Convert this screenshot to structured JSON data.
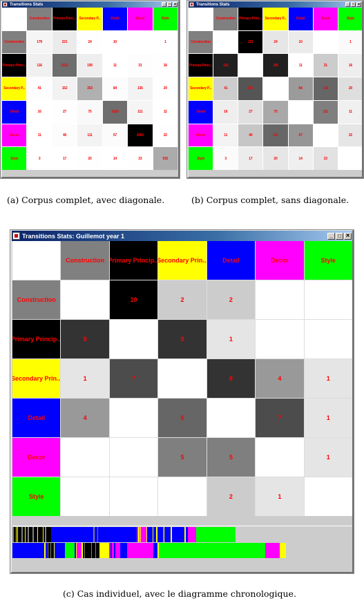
{
  "categories": [
    "Construction",
    "Primary Principle",
    "Secondary Principle",
    "Detail",
    "Decor",
    "Style"
  ],
  "category_colors": {
    "Construction": "#808080",
    "Primary Principle": "#000000",
    "Secondary Principle": "#ffff00",
    "Detail": "#0000ff",
    "Decor": "#ff00ff",
    "Style": "#00ff00"
  },
  "label_color": "#ff0000",
  "windows": {
    "a": {
      "title": "Transitions Stats",
      "header_labels": [
        "Construction",
        "Primary Princ...",
        "Secondary P...",
        "Detail",
        "Decor",
        "Style"
      ],
      "row_labels": [
        "Construction",
        "Primary Princ...",
        "Secondary P...",
        "Detail",
        "Decor",
        "Style"
      ],
      "values": [
        [
          "179",
          "221",
          "24",
          "10",
          "",
          "1"
        ],
        [
          "116",
          "1012",
          "195",
          "11",
          "31",
          "16"
        ],
        [
          "41",
          "152",
          "353",
          "84",
          "136",
          "20"
        ],
        [
          "16",
          "27",
          "75",
          "1620",
          "111",
          "11"
        ],
        [
          "11",
          "40",
          "111",
          "57",
          "2060",
          "22"
        ],
        [
          "3",
          "17",
          "20",
          "14",
          "23",
          "915"
        ]
      ],
      "shades": [
        [
          "#f5f5f5",
          "#ebebeb",
          "#fefefe",
          "#ffffff",
          "#ffffff",
          "#ffffff"
        ],
        [
          "#f0f0f0",
          "#6e6e6e",
          "#eeeeee",
          "#ffffff",
          "#fdfdfd",
          "#fefefe"
        ],
        [
          "#fdfdfd",
          "#f2f2f2",
          "#b0b0b0",
          "#fcfcfc",
          "#f3f3f3",
          "#fefefe"
        ],
        [
          "#ffffff",
          "#fefefe",
          "#f9f9f9",
          "#6e6e6e",
          "#f5f5f5",
          "#ffffff"
        ],
        [
          "#ffffff",
          "#fcfcfc",
          "#f3f3f3",
          "#fbfbfb",
          "#000000",
          "#fefefe"
        ],
        [
          "#ffffff",
          "#ffffff",
          "#fefefe",
          "#ffffff",
          "#fefefe",
          "#ababab"
        ]
      ]
    },
    "b": {
      "title": "Transitions Stats",
      "header_labels": [
        "Construction",
        "Primary Princ...",
        "Secondary P...",
        "Detail",
        "Decor",
        "Style"
      ],
      "row_labels": [
        "Construction",
        "Primary Princ...",
        "Secondary P...",
        "Detail",
        "Decor",
        "Style"
      ],
      "values": [
        [
          "",
          "221",
          "24",
          "10",
          "",
          "1"
        ],
        [
          "116",
          "",
          "195",
          "11",
          "31",
          "16"
        ],
        [
          "41",
          "152",
          "",
          "84",
          "136",
          "20"
        ],
        [
          "16",
          "27",
          "75",
          "",
          "111",
          "11"
        ],
        [
          "11",
          "40",
          "111",
          "57",
          "",
          "22"
        ],
        [
          "3",
          "17",
          "20",
          "14",
          "23",
          ""
        ]
      ],
      "shades": [
        [
          "#ffffff",
          "#000000",
          "#e6e6e6",
          "#ebebeb",
          "#ffffff",
          "#fafafa"
        ],
        [
          "#202020",
          "#ffffff",
          "#202020",
          "#ffffff",
          "#cccccc",
          "#eeeeee"
        ],
        [
          "#cdcdcd",
          "#555555",
          "#ffffff",
          "#9b9b9b",
          "#666666",
          "#dedede"
        ],
        [
          "#eeeeee",
          "#e0e0e0",
          "#a9a9a9",
          "#ffffff",
          "#7f7f7f",
          "#f0f0f0"
        ],
        [
          "#f3f3f3",
          "#c6c6c6",
          "#676767",
          "#969696",
          "#ffffff",
          "#e6e6e6"
        ],
        [
          "#fbfbfb",
          "#ececec",
          "#e6e6e6",
          "#efefef",
          "#e2e2e2",
          "#ffffff"
        ]
      ]
    },
    "c": {
      "title": "Transitions Stats: Guillemot year 1",
      "header_labels": [
        "Construction",
        "Primary Princip...",
        "Secondary Prin...",
        "Detail",
        "Decor",
        "Style"
      ],
      "row_labels": [
        "Construction",
        "Primary Princip...",
        "Secondary Prin...",
        "Detail",
        "Decor",
        "Style"
      ],
      "values": [
        [
          "",
          "10",
          "2",
          "2",
          "",
          ""
        ],
        [
          "8",
          "",
          "8",
          "1",
          "",
          ""
        ],
        [
          "1",
          "7",
          "",
          "8",
          "4",
          "1"
        ],
        [
          "4",
          "",
          "6",
          "",
          "7",
          "1"
        ],
        [
          "",
          "",
          "5",
          "5",
          "",
          "1"
        ],
        [
          "",
          "",
          "",
          "2",
          "1",
          ""
        ]
      ],
      "shades": [
        [
          "#ffffff",
          "#000000",
          "#cccccc",
          "#cccccc",
          "#ffffff",
          "#ffffff"
        ],
        [
          "#333333",
          "#ffffff",
          "#333333",
          "#e5e5e5",
          "#ffffff",
          "#ffffff"
        ],
        [
          "#e5e5e5",
          "#4c4c4c",
          "#ffffff",
          "#333333",
          "#999999",
          "#e5e5e5"
        ],
        [
          "#999999",
          "#ffffff",
          "#666666",
          "#ffffff",
          "#4c4c4c",
          "#e5e5e5"
        ],
        [
          "#ffffff",
          "#ffffff",
          "#7f7f7f",
          "#7f7f7f",
          "#ffffff",
          "#e5e5e5"
        ],
        [
          "#ffffff",
          "#ffffff",
          "#ffffff",
          "#cccccc",
          "#e5e5e5",
          "#ffffff"
        ]
      ],
      "timeline": {
        "rows": [
          [
            [
              "Construction",
              2
            ],
            [
              "Primary Principle",
              3
            ],
            [
              "Secondary Principle",
              1
            ],
            [
              "Primary Principle",
              1
            ],
            [
              "Secondary Principle",
              1
            ],
            [
              "Primary Principle",
              5
            ],
            [
              "Construction",
              2
            ],
            [
              "Primary Principle",
              3
            ],
            [
              "Secondary Principle",
              1
            ],
            [
              "Primary Principle",
              3
            ],
            [
              "Construction",
              2
            ],
            [
              "Primary Principle",
              5
            ],
            [
              "Construction",
              2
            ],
            [
              "Primary Principle",
              5
            ],
            [
              "Secondary Principle",
              1
            ],
            [
              "Primary Principle",
              7
            ],
            [
              "Secondary Principle",
              1
            ],
            [
              "Primary Principle",
              2
            ],
            [
              "Construction",
              2
            ],
            [
              "Primary Principle",
              7
            ],
            [
              "Detail",
              61
            ],
            [
              "Construction",
              2
            ],
            [
              "Detail",
              4
            ],
            [
              "Construction",
              1
            ],
            [
              "Detail",
              56
            ],
            [
              "Decor",
              2
            ],
            [
              "Secondary Principle",
              2
            ],
            [
              "Decor",
              1
            ],
            [
              "Secondary Principle",
              1
            ],
            [
              "Decor",
              8
            ],
            [
              "Secondary Principle",
              1
            ],
            [
              "Detail",
              8
            ],
            [
              "Secondary Principle",
              1
            ],
            [
              "Detail",
              4
            ],
            [
              "Secondary Principle",
              2
            ],
            [
              "Detail",
              8
            ],
            [
              "Decor",
              1
            ],
            [
              "Secondary Principle",
              1
            ],
            [
              "Detail",
              9
            ],
            [
              "Secondary Principle",
              2
            ],
            [
              "Detail",
              18
            ],
            [
              "Secondary Principle",
              2
            ],
            [
              "Detail",
              3
            ],
            [
              "Decor",
              12
            ],
            [
              "Style",
              57
            ]
          ],
          [
            [
              "Detail",
              46
            ],
            [
              "Secondary Principle",
              2
            ],
            [
              "Detail",
              2
            ],
            [
              "Primary Principle",
              1
            ],
            [
              "Construction",
              1
            ],
            [
              "Primary Principle",
              3
            ],
            [
              "Construction",
              1
            ],
            [
              "Primary Principle",
              4
            ],
            [
              "Secondary Principle",
              1
            ],
            [
              "Detail",
              15
            ],
            [
              "Style",
              14
            ],
            [
              "Detail",
              2
            ],
            [
              "Secondary Principle",
              1
            ],
            [
              "Decor",
              7
            ],
            [
              "Secondary Principle",
              2
            ],
            [
              "Primary Principle",
              2
            ],
            [
              "Construction",
              1
            ],
            [
              "Primary Principle",
              9
            ],
            [
              "Construction",
              1
            ],
            [
              "Primary Principle",
              5
            ],
            [
              "Construction",
              1
            ],
            [
              "Primary Principle",
              5
            ],
            [
              "Secondary Principle",
              14
            ],
            [
              "Decor",
              2
            ],
            [
              "Detail",
              2
            ],
            [
              "Decor",
              3
            ],
            [
              "Detail",
              2
            ],
            [
              "Decor",
              7
            ],
            [
              "Detail",
              10
            ],
            [
              "Decor",
              38
            ],
            [
              "Detail",
              6
            ],
            [
              "Secondary Principle",
              2
            ],
            [
              "Style",
              154
            ],
            [
              "Decor",
              21
            ],
            [
              "Secondary Principle",
              9
            ]
          ]
        ]
      }
    }
  },
  "captions": {
    "a": "(a) Corpus complet, avec diagonale.",
    "b": "(b) Corpus complet, sans diagonale.",
    "c": "(c) Cas individuel, avec le diagramme chronologique."
  },
  "window_controls": {
    "minimize": "_",
    "maximize": "□",
    "close": "×"
  }
}
